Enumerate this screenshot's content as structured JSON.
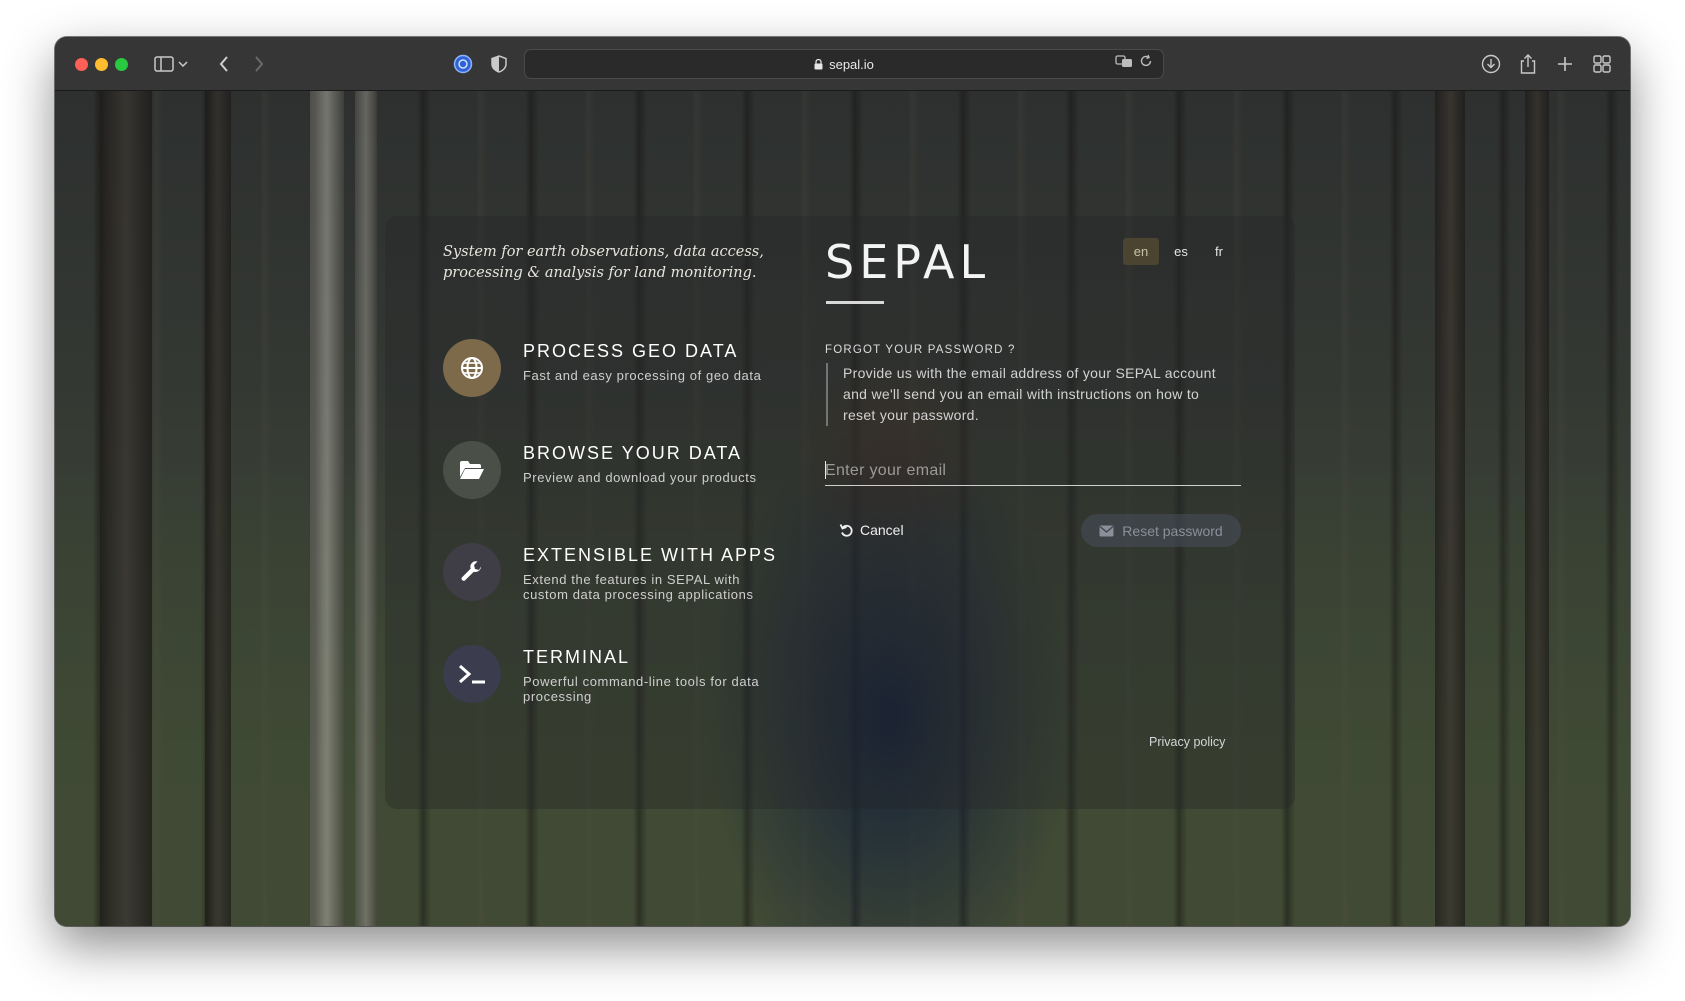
{
  "browser": {
    "url": "sepal.io"
  },
  "sidebar": {
    "tagline": "System for earth observations, data access, processing & analysis for land monitoring.",
    "features": [
      {
        "title": "PROCESS GEO DATA",
        "description": "Fast and easy processing of geo data",
        "icon": "globe-icon",
        "color": "#7d6a4a"
      },
      {
        "title": "BROWSE YOUR DATA",
        "description": "Preview and download your products",
        "icon": "folder-open-icon",
        "color": "#4a4f48"
      },
      {
        "title": "EXTENSIBLE WITH APPS",
        "description": "Extend the features in SEPAL with custom data processing applications",
        "icon": "wrench-icon",
        "color": "#3f3d45"
      },
      {
        "title": "TERMINAL",
        "description": "Powerful command-line tools for data processing",
        "icon": "terminal-icon",
        "color": "#3b3c4d"
      }
    ]
  },
  "main": {
    "logo": "SEPAL",
    "languages": [
      {
        "code": "en",
        "active": true
      },
      {
        "code": "es",
        "active": false
      },
      {
        "code": "fr",
        "active": false
      }
    ],
    "forgot_title": "FORGOT YOUR PASSWORD ?",
    "forgot_text": "Provide us with the email address of your SEPAL account and we'll send you an email with instructions on how to reset your password.",
    "email_placeholder": "Enter your email",
    "email_value": "",
    "cancel_label": "Cancel",
    "reset_label": "Reset password",
    "privacy_label": "Privacy policy"
  }
}
